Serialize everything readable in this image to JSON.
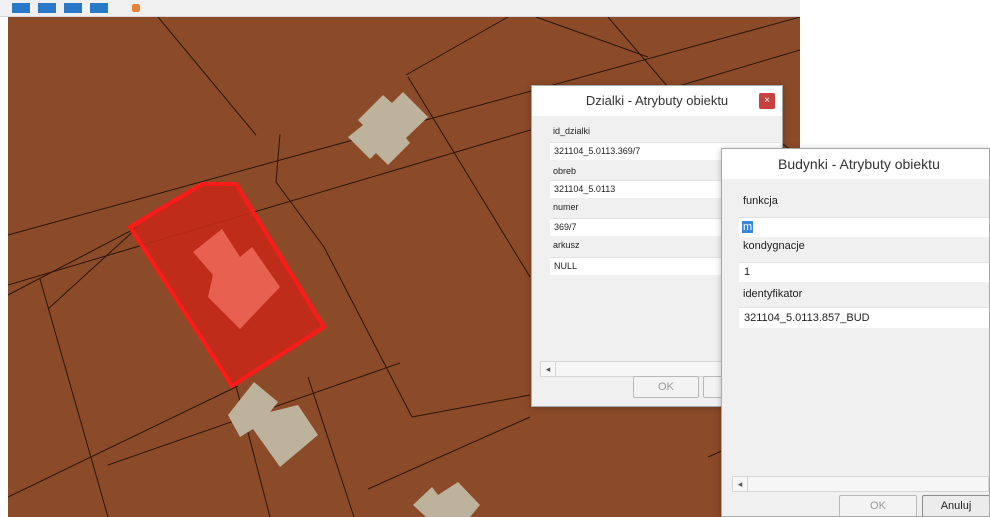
{
  "toolbar": {
    "icons": [
      "toolbar-icon-1",
      "toolbar-icon-2",
      "toolbar-icon-3",
      "toolbar-icon-4",
      "toolbar-icon-5"
    ]
  },
  "map": {
    "parcel_fill_color": "#8b4a28",
    "building_color": "#bdb29b",
    "selection_color": "#ff1a1a",
    "line_color": "#2a1608"
  },
  "dialog_dzialki": {
    "title": "Dzialki - Atrybuty obiektu",
    "close_glyph": "×",
    "fields": [
      {
        "label": "id_dzialki",
        "value": "321104_5.0113.369/7"
      },
      {
        "label": "obreb",
        "value": "321104_5.0113"
      },
      {
        "label": "numer",
        "value": "369/7"
      },
      {
        "label": "arkusz",
        "value": "NULL"
      }
    ],
    "ok_label": "OK",
    "scroll_arrow": "◂"
  },
  "dialog_budynki": {
    "title": "Budynki - Atrybuty obiektu",
    "fields": [
      {
        "label": "funkcja",
        "value": "m"
      },
      {
        "label": "kondygnacje",
        "value": "1"
      },
      {
        "label": "identyfikator",
        "value": "321104_5.0113.857_BUD"
      }
    ],
    "ok_label": "OK",
    "cancel_label": "Anuluj",
    "scroll_arrow": "◂"
  }
}
